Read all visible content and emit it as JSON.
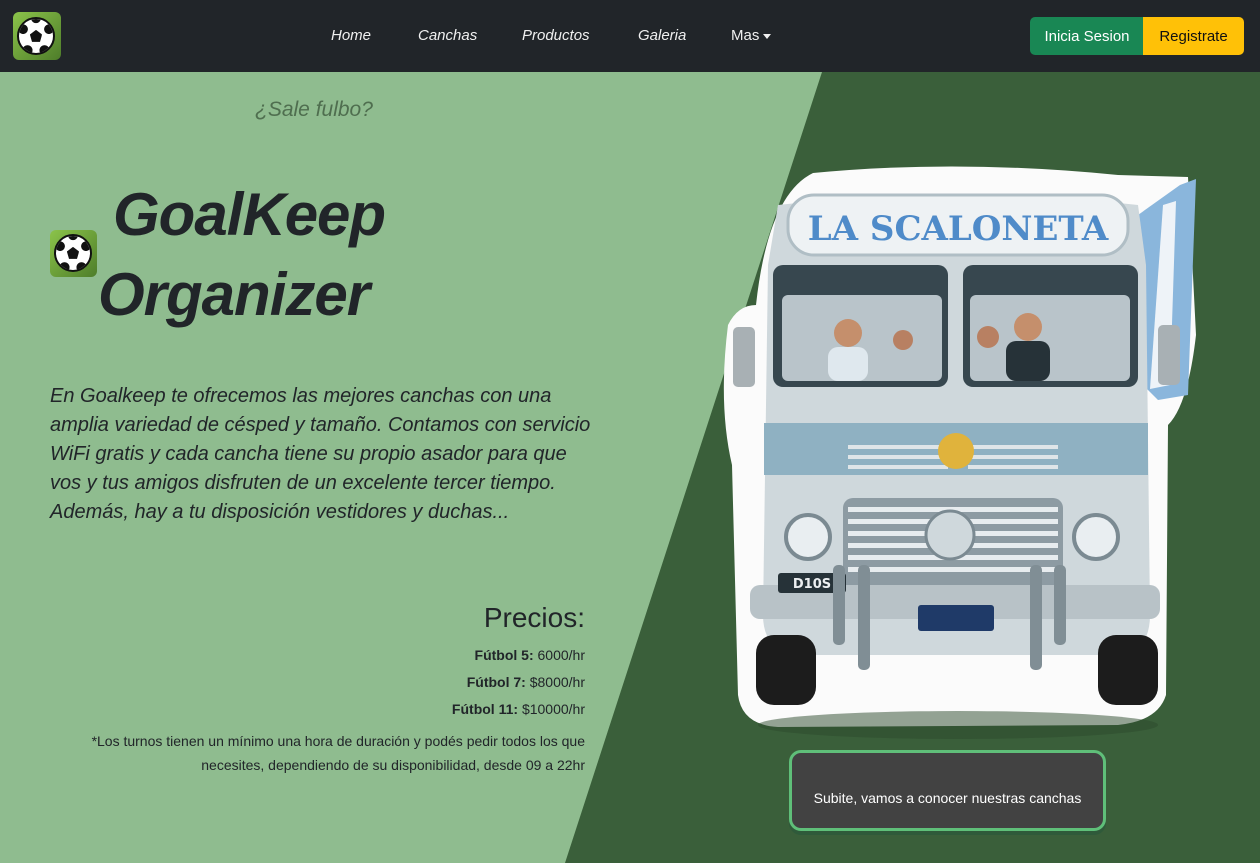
{
  "nav": {
    "links": [
      "Home",
      "Canchas",
      "Productos",
      "Galeria"
    ],
    "more_label": "Mas",
    "login_label": "Inicia Sesion",
    "register_label": "Registrate"
  },
  "hero": {
    "tagline": "¿Sale fulbo?",
    "title_line1": "GoalKeep",
    "title_line2": "Organizer",
    "description": "En Goalkeep te ofrecemos las mejores canchas con una amplia variedad de césped y tamaño. Contamos con servicio WiFi gratis y cada cancha tiene su propio asador para que vos y tus amigos disfruten de un excelente tercer tiempo. Además, hay a tu disposición vestidores y duchas...",
    "prices_heading": "Precios:",
    "prices": [
      {
        "label": "Fútbol 5:",
        "value": "6000/hr"
      },
      {
        "label": "Fútbol 7:",
        "value": "$8000/hr"
      },
      {
        "label": "Fútbol 11:",
        "value": "$10000/hr"
      }
    ],
    "note": "*Los turnos tienen un mínimo una hora de duración y podés pedir todos los que necesites, dependiendo de su disponibilidad, desde 09 a 22hr",
    "cta_label": "Subite, vamos a conocer nuestras canchas"
  },
  "bus": {
    "sign": "LA SCALONETA",
    "plate": "D10S"
  },
  "colors": {
    "navbar": "#212529",
    "light_green": "#8fbc8f",
    "dark_green": "#3a5f3a",
    "login": "#198754",
    "register": "#ffc107",
    "cta_border": "#5fbf79"
  },
  "icons": {
    "brand": "soccer-ball-icon",
    "title": "soccer-ball-icon"
  }
}
